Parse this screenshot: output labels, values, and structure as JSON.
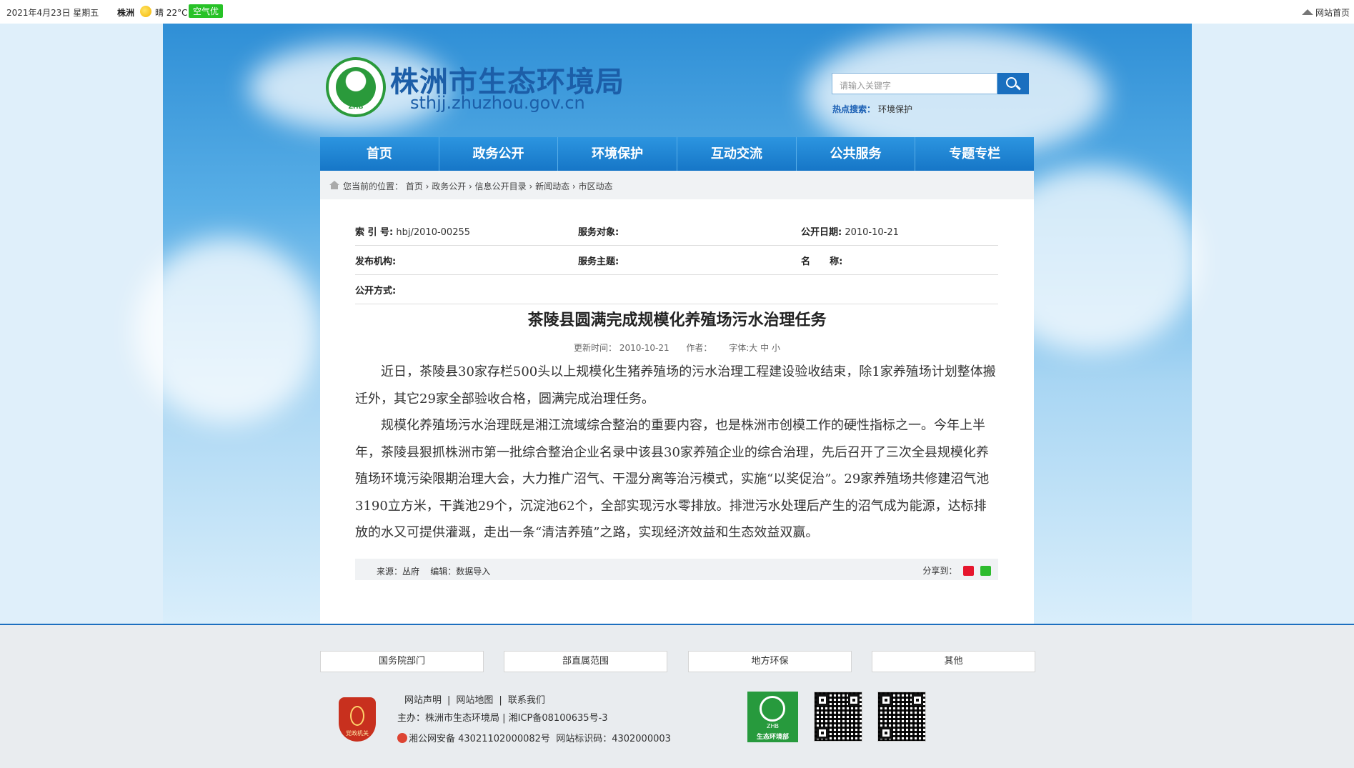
{
  "topbar": {
    "date": "2021年4月23日 星期五",
    "city": "株洲",
    "weather": "晴 22°C",
    "air_quality": "空气优",
    "home_link": "网站首页"
  },
  "header": {
    "title": "株洲市生态环境局",
    "url": "sthjj.zhuzhou.gov.cn",
    "logo_text": "ZHB",
    "search_placeholder": "请输入关键字",
    "hot_label": "热点搜索：",
    "hot_keyword": "环境保护"
  },
  "nav": {
    "items": [
      "首页",
      "政务公开",
      "环境保护",
      "互动交流",
      "公共服务",
      "专题专栏"
    ]
  },
  "breadcrumb": {
    "text": "您当前的位置： 首页 › 政务公开 › 信息公开目录 › 新闻动态 › 市区动态"
  },
  "meta": {
    "index_label": "索  引 号:",
    "index_value": "hbj/2010-00255",
    "target_label": "服务对象:",
    "target_value": "",
    "date_label": "公开日期:",
    "date_value": "2010-10-21",
    "org_label": "发布机构:",
    "org_value": "",
    "topic_label": "服务主题:",
    "topic_value": "",
    "name_label": "名      称:",
    "name_value": "",
    "mode_label": "公开方式:",
    "mode_value": ""
  },
  "article": {
    "title": "茶陵县圆满完成规模化养殖场污水治理任务",
    "updated": "更新时间：  2010-10-21",
    "author": "作者：",
    "font_size": "字体:大 中 小",
    "paragraphs": [
      "近日，茶陵县30家存栏500头以上规模化生猪养殖场的污水治理工程建设验收结束，除1家养殖场计划整体搬迁外，其它29家全部验收合格，圆满完成治理任务。",
      "规模化养殖场污水治理既是湘江流域综合整治的重要内容，也是株洲市创模工作的硬性指标之一。今年上半年，茶陵县狠抓株洲市第一批综合整治企业名录中该县30家养殖企业的综合治理，先后召开了三次全县规模化养殖场环境污染限期治理大会，大力推广沼气、干湿分离等治污模式，实施“以奖促治”。29家养殖场共修建沼气池3190立方米，干粪池29个，沉淀池62个，全部实现污水零排放。排泄污水处理后产生的沼气成为能源，达标排放的水又可提供灌溉，走出一条“清洁养殖”之路，实现经济效益和生态效益双赢。"
    ],
    "source_line": "来源：丛府    编辑：数据导入",
    "share_label": "分享到："
  },
  "footer": {
    "link_boxes": [
      "国务院部门",
      "部直属范围",
      "地方环保",
      "其他"
    ],
    "links": [
      "网站声明",
      "网站地图",
      "联系我们"
    ],
    "host": "主办：株洲市生态环境局 | 湘ICP备08100635号-3",
    "police": "湘公网安备 43021102000082号  网站标识码：4302000003",
    "badge_text": "党政机关",
    "zhb_logo_top": "ZHB",
    "zhb_logo_bottom": "生态环境部"
  },
  "colors": {
    "brand_blue": "#1c5ea8",
    "nav_blue": "#1676c7",
    "air_green": "#27c227",
    "logo_green": "#2a9a3b"
  }
}
